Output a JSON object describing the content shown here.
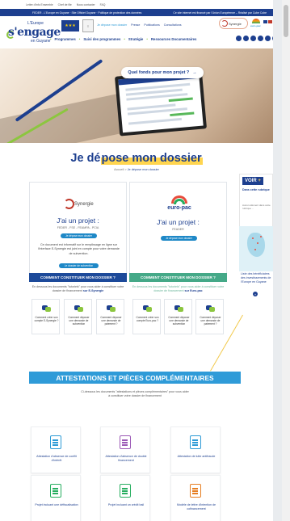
{
  "top_links": [
    "Lettre d'info Ensemble",
    "Chef de file",
    "Nous contacter",
    "FAQ"
  ],
  "blue_bar": {
    "left": "FEDER - L'Europe en Guyane · Site Officiel Guyane · Politique de protection des données",
    "right": "Ce site internet est financé par l'Union Européenne – Réalisé par Cube Cube"
  },
  "logo": {
    "line1": "L'Europe",
    "line2": "s'engage",
    "line3": "en Guyane"
  },
  "mini_nav": [
    "Je dépose mon dossier",
    "Presse",
    "Publications",
    "Consultations"
  ],
  "nav": [
    "Programmes",
    "Suivi des programmes",
    "Stratégie",
    "Ressources Documentaires"
  ],
  "hero": {
    "cta_label": "Quel fonds pour mon projet ?",
    "cta_arrow": "→"
  },
  "page": {
    "title_prefix": "Je dé",
    "title_highlight": "pose mon dossier",
    "breadcrumb_home": "Accueil",
    "breadcrumb_sep": ">",
    "breadcrumb_current": "Je dépose mon dossier"
  },
  "left_card": {
    "logo_text": "Synergie",
    "title": "J'ai un projet :",
    "funds": "FEDER - FSE - FEAMPA - PCIA",
    "button": "Je dépose mon dossier",
    "description": "Ce document est informatif sur le remplissage en ligne sur l'interface E-Synergie est joint en compte pour votre demande de subvention.",
    "doc_button": "Le dossier de subvention",
    "strip_title": "COMMENT CONSTITUER MON DOSSIER ?",
    "below_text": "En dessous les documents \"tutoriels\" pour vous aider à constituer votre dossier de financement",
    "below_bold": "sur E-Synergie",
    "minis": [
      "Comment créer son compte E-Synergie ?",
      "Comment déposer une demande de subvention",
      "Comment déposer une demande de paiement ?"
    ]
  },
  "right_card": {
    "logo_text": "euro-pac",
    "title": "J'ai un projet :",
    "funds": "FEADER",
    "button": "Je dépose mon dossier",
    "strip_title": "COMMENT CONSTITUER MON DOSSIER ?",
    "below_text": "En dessous les documents \"tutoriels\" pour vous aider à constituer votre dossier de financement",
    "below_bold": "sur Euro-pac",
    "minis": [
      "Comment créer son compte Euro-pac ?",
      "Comment déposer une demande de subvention",
      "Comment déposer une demande de paiement ?"
    ]
  },
  "sidebar": {
    "voir": "VOIR",
    "plus": "+",
    "dans": "Dans cette rubrique",
    "aucun": "Aucun élément dans cette rubrique ...",
    "map_text": "Liste des bénéficiaires des investissements de l'Europe en Guyane",
    "map_button": "+"
  },
  "attestations": {
    "title": "ATTESTATIONS ET PIÈCES COMPLÉMENTAIRES",
    "subtitle": "Ci-dessous les documents \"attestations et pièces complémentaires\" pour vous aider à constituer votre dossier de financement",
    "cards": [
      {
        "label": "Attestation d'absence de conflit d'intérêt",
        "color": "#2e9bd6"
      },
      {
        "label": "Attestation d'absence de double financement",
        "color": "#9b59b6"
      },
      {
        "label": "Attestation de lutte antifraude",
        "color": "#2e9bd6"
      },
      {
        "label": "Projet incluant une défiscalisation",
        "color": "#27ae60"
      },
      {
        "label": "Projet incluant un crédit bail",
        "color": "#27ae60"
      },
      {
        "label": "Modèle de lettre d'intention de cofinancement",
        "color": "#e67e22"
      }
    ]
  },
  "colors": {
    "primary": "#1d3f8f",
    "accent_green": "#8cc63f",
    "cyan": "#2f9bd8",
    "teal": "#45a988",
    "highlight": "#ffd54f"
  }
}
